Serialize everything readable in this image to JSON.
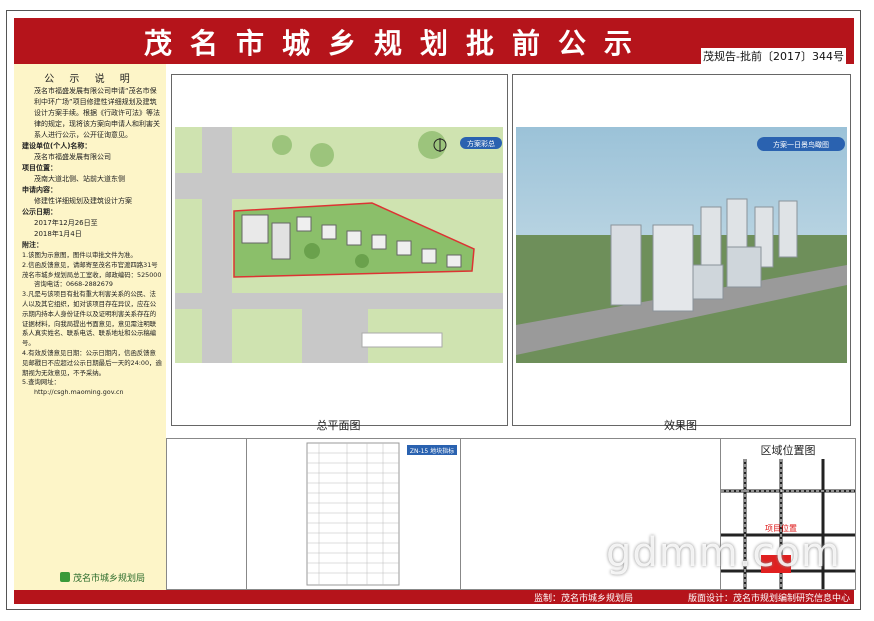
{
  "header": {
    "title": "茂名市城乡规划批前公示",
    "doc_no": "茂规告-批前〔2017〕344号"
  },
  "notice": {
    "title": "公 示 说 明",
    "intro": "茂名市福盛发展有限公司申请“茂名市保利中环广场”项目修建性详细规划及建筑设计方案手续。根据《行政许可法》等法律的规定，现将该方案向申请人和利害关系人进行公示，公开征询意见。",
    "applicant_label": "建设单位(个人)名称：",
    "applicant": "茂名市福盛发展有限公司",
    "location_label": "项目位置：",
    "location": "茂南大道北侧、站前大道东侧",
    "content_label": "申请内容：",
    "content": "修建性详细规划及建筑设计方案",
    "date_label": "公示日期：",
    "date_from": "2017年12月26日至",
    "date_to": "2018年1月4日",
    "notes_label": "附注：",
    "notes": [
      "1.该图为示意图，图件以审批文件为准。",
      "2.信函反馈意见，请邮寄至茂名市官渡四路31号茂名市城乡规划局总工室收，邮政编码：525000",
      "咨询电话：0668-2882679",
      "3.凡是与该项目有批有重大利害关系的公民、法人以及其它组织，如对该项目存在异议，应在公示期内持本人身份证件以及证明利害关系存在的证据材料，向我局提出书面意见，意见需注明联系人真实姓名、联系电话、联系地址和公示稿编号。",
      "4.有效反馈意见日期：公示日期内，信函反馈意见邮戳日不应超过公示日期最后一天的24:00，逾期视为无效意见，不予采纳。",
      "5.查询网址：",
      "http://csgh.maoming.gov.cn"
    ],
    "logo_text": "茂名市城乡规划局"
  },
  "panels": {
    "site_plan_tag": "方案彩总",
    "site_plan_caption": "总平面图",
    "render_tag": "方案一日景鸟瞰图",
    "render_caption": "效果图",
    "index_tag": "ZN-15 地块指标",
    "location_caption": "区域位置图",
    "location_marker": "项目位置"
  },
  "footer": {
    "supervisor": "监制：茂名市城乡规划局",
    "designer": "版面设计：茂名市规划编制研究信息中心"
  },
  "watermark": "gdmm.com"
}
